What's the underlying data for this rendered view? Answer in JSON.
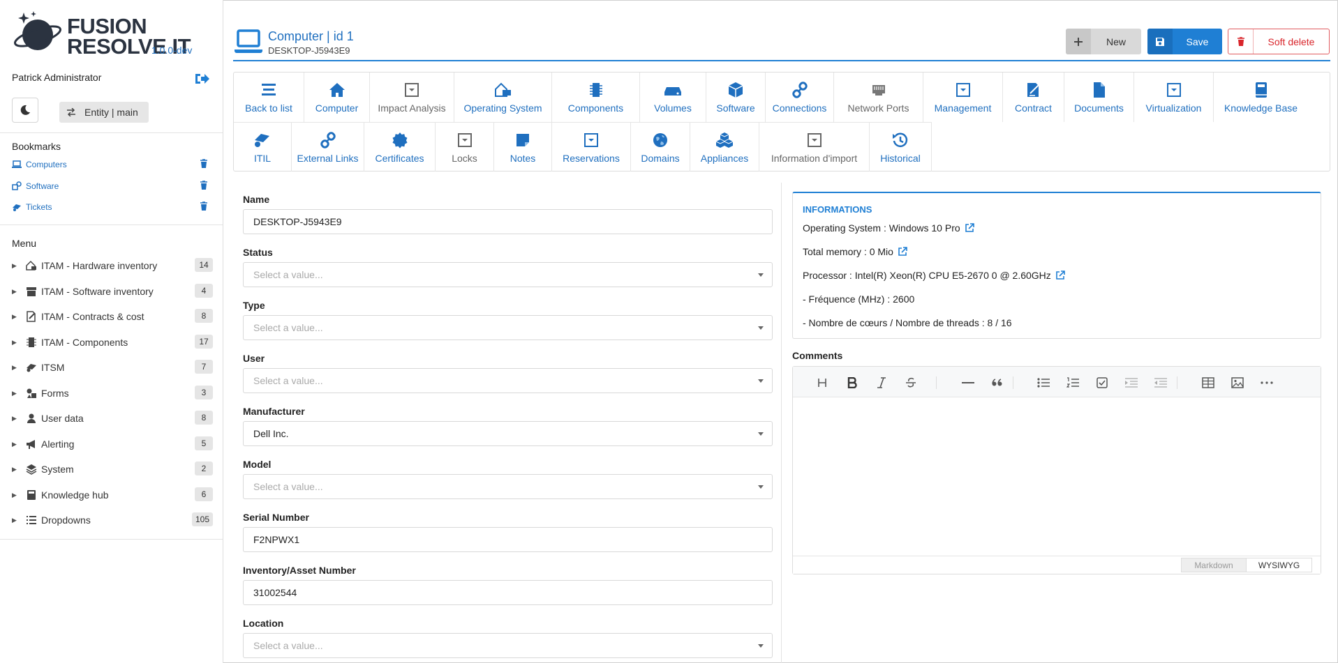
{
  "app": {
    "logo_line1": "FUSION",
    "logo_line2": "RESOLVE IT",
    "version": "1.0.0-dev"
  },
  "user": {
    "name": "Patrick Administrator"
  },
  "entity": {
    "label": "Entity | main"
  },
  "bookmarks": {
    "title": "Bookmarks",
    "items": [
      {
        "label": "Computers",
        "icon": "laptop-icon"
      },
      {
        "label": "Software",
        "icon": "software-icon"
      },
      {
        "label": "Tickets",
        "icon": "tickets-icon"
      }
    ]
  },
  "menu": {
    "title": "Menu",
    "items": [
      {
        "label": "ITAM - Hardware inventory",
        "count": "14"
      },
      {
        "label": "ITAM - Software inventory",
        "count": "4"
      },
      {
        "label": "ITAM - Contracts & cost",
        "count": "8"
      },
      {
        "label": "ITAM - Components",
        "count": "17"
      },
      {
        "label": "ITSM",
        "count": "7"
      },
      {
        "label": "Forms",
        "count": "3"
      },
      {
        "label": "User data",
        "count": "8"
      },
      {
        "label": "Alerting",
        "count": "5"
      },
      {
        "label": "System",
        "count": "2"
      },
      {
        "label": "Knowledge hub",
        "count": "6"
      },
      {
        "label": "Dropdowns",
        "count": "105"
      }
    ]
  },
  "header": {
    "title": "Computer | id 1",
    "subtitle": "DESKTOP-J5943E9",
    "new_label": "New",
    "save_label": "Save",
    "delete_label": "Soft delete"
  },
  "tabs": [
    "Back to list",
    "Computer",
    "Impact Analysis",
    "Operating System",
    "Components",
    "Volumes",
    "Software",
    "Connections",
    "Network Ports",
    "Management",
    "Contract",
    "Documents",
    "Virtualization",
    "Knowledge Base",
    "ITIL",
    "External Links",
    "Certificates",
    "Locks",
    "Notes",
    "Reservations",
    "Domains",
    "Appliances",
    "Information d'import",
    "Historical"
  ],
  "form": {
    "name_label": "Name",
    "name_value": "DESKTOP-J5943E9",
    "status_label": "Status",
    "status_placeholder": "Select a value...",
    "type_label": "Type",
    "type_placeholder": "Select a value...",
    "user_label": "User",
    "user_placeholder": "Select a value...",
    "manufacturer_label": "Manufacturer",
    "manufacturer_value": "Dell Inc.",
    "model_label": "Model",
    "model_placeholder": "Select a value...",
    "serial_label": "Serial Number",
    "serial_value": "F2NPWX1",
    "inventory_label": "Inventory/Asset Number",
    "inventory_value": "31002544",
    "location_label": "Location",
    "location_placeholder": "Select a value..."
  },
  "info": {
    "title": "INFORMATIONS",
    "os": "Operating System : Windows 10 Pro",
    "memory": "Total memory : 0 Mio",
    "processor": "Processor : Intel(R) Xeon(R) CPU E5-2670 0 @ 2.60GHz",
    "frequency": "- Fréquence (MHz) : 2600",
    "cores": "- Nombre de cœurs / Nombre de threads : 8 / 16"
  },
  "comments": {
    "label": "Comments",
    "mode_markdown": "Markdown",
    "mode_wysiwyg": "WYSIWYG"
  },
  "colors": {
    "accent": "#1f7fd4",
    "danger": "#d9252b"
  }
}
